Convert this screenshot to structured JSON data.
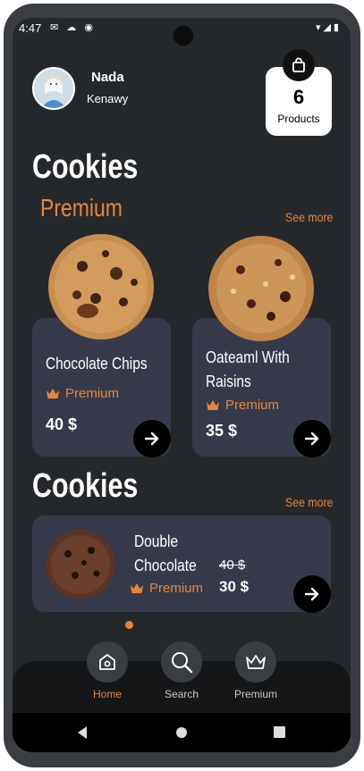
{
  "status": {
    "time": "4:47",
    "left_icons": "✉ ☁ ◉",
    "right_icons": "▾◢▮"
  },
  "user": {
    "first_name": "Nada",
    "last_name": "Kenawy"
  },
  "cart": {
    "count": "6",
    "label": "Products"
  },
  "section1": {
    "title": "Cookies",
    "subtitle": "Premium",
    "see_more": "See more",
    "cards": [
      {
        "name": "Chocolate Chips",
        "badge": "Premium",
        "price": "40 $"
      },
      {
        "name": "Oateaml With Raisins",
        "badge": "Premium",
        "price": "35 $"
      }
    ]
  },
  "section2": {
    "title": "Cookies",
    "see_more": "See more",
    "item": {
      "name": "Double Chocolate",
      "badge": "Premium",
      "old_price": "40 $",
      "price": "30 $"
    }
  },
  "nav": {
    "items": [
      {
        "label": "Home",
        "icon": "home-icon",
        "active": true
      },
      {
        "label": "Search",
        "icon": "search-icon",
        "active": false
      },
      {
        "label": "Premium",
        "icon": "crown-icon",
        "active": false
      }
    ],
    "active_color": "#e8853a"
  },
  "colors": {
    "accent": "#e8853a",
    "background": "#25282b",
    "card": "#363a4a"
  }
}
